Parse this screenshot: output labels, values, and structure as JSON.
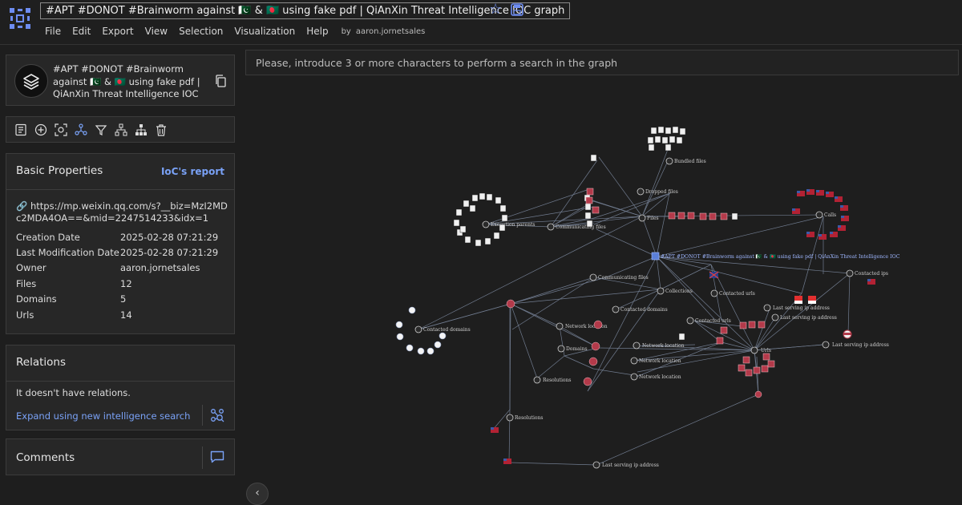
{
  "app": {
    "graph_title": "#APT #DONOT #Brainworm against 🇵🇰 & 🇧🇩 using fake pdf | QiAnXin Threat Intelligence IOC graph",
    "logo_icon": "graph-nodes-icon",
    "accent_color": "#6d8cf0"
  },
  "menu": {
    "items": [
      "File",
      "Edit",
      "Export",
      "View",
      "Selection",
      "Visualization",
      "Help"
    ],
    "by_label": "by",
    "owner": "aaron.jornetsales"
  },
  "card": {
    "title": "#APT #DONOT #Brainworm against 🇵🇰 & 🇧🇩 using fake pdf | QiAnXin Threat Intelligence IOC",
    "icon": "collection-layers-icon"
  },
  "basic_properties": {
    "heading": "Basic Properties",
    "report_link": "IoC's report",
    "url": "🔗 https://mp.weixin.qq.com/s?__biz=MzI2MDc2MDA4OA==&mid=2247514233&idx=1",
    "rows": [
      {
        "key": "Creation Date",
        "value": "2025-02-28 07:21:29"
      },
      {
        "key": "Last Modification Date",
        "value": "2025-02-28 07:21:29"
      },
      {
        "key": "Owner",
        "value": "aaron.jornetsales"
      },
      {
        "key": "Files",
        "value": "12"
      },
      {
        "key": "Domains",
        "value": "5"
      },
      {
        "key": "Urls",
        "value": "14"
      }
    ]
  },
  "relations": {
    "heading": "Relations",
    "empty_text": "It doesn't have relations.",
    "expand_link": "Expand using new intelligence search"
  },
  "comments": {
    "heading": "Comments"
  },
  "search": {
    "placeholder": "Please, introduce 3 or more characters to perform a search in the graph"
  },
  "graph": {
    "title_node": "#APT #DONOT #Brainworm against 🇵🇰 & 🇧🇩 using fake pdf | QiAnXin Threat Intelligence IOC",
    "labels": {
      "bundled_files": "Bundled files",
      "dropped_files": "Dropped files",
      "files": "Files",
      "execution_parents": "Execution parents",
      "communicating_files_1": "Communicating files",
      "communicating_files_2": "Communicating files",
      "collections": "Collections",
      "contacted_domains_1": "Contacted domains",
      "contacted_domains_2": "Contacted domains",
      "contacted_urls_1": "Contacted urls",
      "contacted_urls_2": "Contacted urls",
      "contacted_ips": "Contacted ips",
      "calls": "Calls",
      "urls": "Urls",
      "network_location_1": "Network location",
      "network_location_2": "Network location",
      "network_location_3": "Network location",
      "network_location_4": "Network location",
      "domains": "Domains",
      "resolutions_1": "Resolutions",
      "resolutions_2": "Resolutions",
      "last_serving_ip_1": "Last serving ip address",
      "last_serving_ip_2": "Last serving ip address",
      "last_serving_ip_3": "Last serving ip address",
      "last_serving_ip_4": "Last serving ip address"
    },
    "colors": {
      "edge": "#8c9bb5",
      "node_file": "#f0f0f0",
      "node_malicious": "#b33a4a",
      "node_hub": "#2a2a2a",
      "highlight": "#5b7fd8"
    }
  }
}
